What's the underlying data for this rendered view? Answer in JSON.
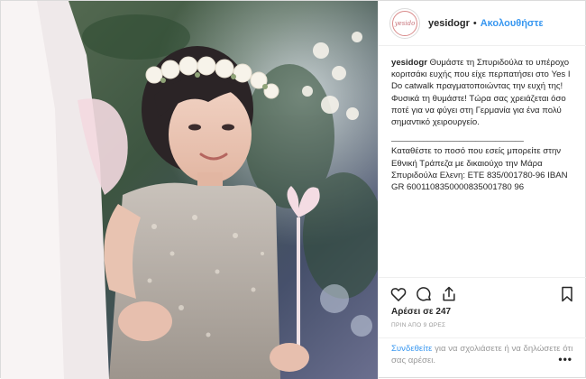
{
  "header": {
    "avatar_text": "yesido",
    "username": "yesidogr",
    "separator": "•",
    "follow_label": "Ακολουθήστε"
  },
  "caption": {
    "username": "yesidogr",
    "paragraph1": "Θυμάστε τη Σπυριδούλα το υπέροχο κοριτσάκι ευχής που είχε περπατήσει στο Yes I Do catwalk πραγματοποιώντας την ευχή της! Φυσικά τη θυμάστε! Τώρα σας χρειάζεται όσο ποτέ για να φύγει στη Γερμανία για ένα πολύ σημαντικό χειρουργείο.",
    "divider": "_________________________________",
    "paragraph2": "Καταθέστε το ποσό που εσείς μπορείτε στην Εθνική Τράπεζα με δικαιούχο την Μάρα Σπυριδούλα Ελενη: ΕΤΕ 835/001780-96 IBAN GR 6001108350000835001780 96"
  },
  "actions": {
    "like_icon": "heart-icon",
    "comment_icon": "comment-icon",
    "share_icon": "share-icon",
    "save_icon": "bookmark-icon"
  },
  "likes_text": "Αρέσει σε 247",
  "time_text": "ΠΡΙΝ ΑΠΟ 9 ΩΡΕΣ",
  "comment_prompt": {
    "login_label": "Συνδεθείτε",
    "rest": " για να σχολιάσετε ή να δηλώσετε ότι σας αρέσει."
  },
  "more_label": "•••",
  "colors": {
    "link": "#3897f0",
    "muted": "#999999",
    "text": "#262626",
    "border": "#dbdbdb"
  }
}
